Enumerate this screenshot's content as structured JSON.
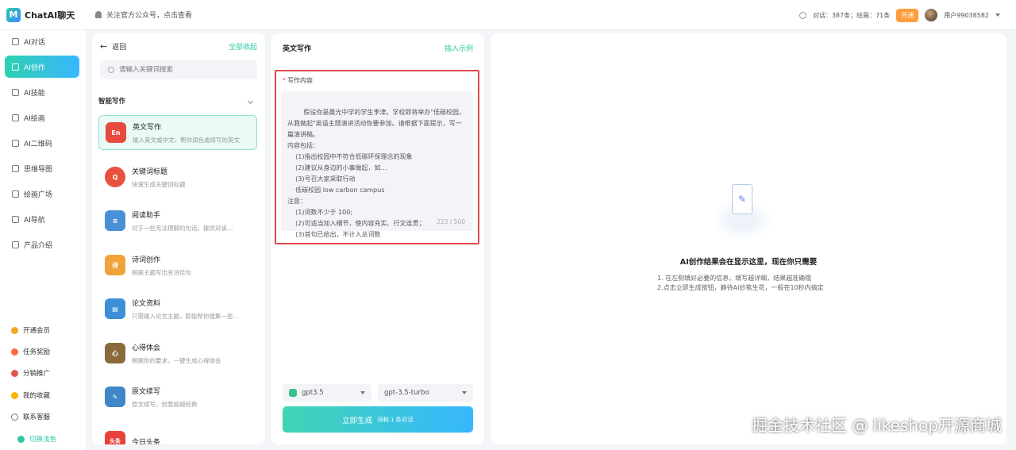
{
  "app": {
    "name": "ChatAI聊天",
    "logo_letter": "M",
    "notice": "关注官方公众号，点击查看"
  },
  "top_right": {
    "stats": "对话：387条；绘画：71条",
    "vip_label": "开通",
    "username": "用户99038582"
  },
  "nav": {
    "items": [
      {
        "label": "AI对话",
        "icon": "chat-icon"
      },
      {
        "label": "AI创作",
        "icon": "pen-icon",
        "active": true
      },
      {
        "label": "AI技能",
        "icon": "grid-icon"
      },
      {
        "label": "AI绘画",
        "icon": "palette-icon"
      },
      {
        "label": "AI二维码",
        "icon": "qrcode-icon"
      },
      {
        "label": "思维导图",
        "icon": "mindmap-icon"
      },
      {
        "label": "绘画广场",
        "icon": "gallery-icon"
      },
      {
        "label": "AI导航",
        "icon": "nav-icon"
      },
      {
        "label": "产品介绍",
        "icon": "doc-icon"
      }
    ],
    "bottom": [
      {
        "label": "开通会员",
        "color": "#f5a623"
      },
      {
        "label": "任务奖励",
        "color": "#ff6a3d"
      },
      {
        "label": "分销推广",
        "color": "#e2574c"
      },
      {
        "label": "我的收藏",
        "color": "#f7b500"
      },
      {
        "label": "联系客服",
        "color": "#777777"
      },
      {
        "label": "切换浅色",
        "color": "#2ec8a6"
      }
    ]
  },
  "panel1": {
    "back_label": "返回",
    "collapse_label": "全部收起",
    "search_placeholder": "请输入关键词搜索",
    "section_title": "智能写作",
    "cards": [
      {
        "title": "英文写作",
        "desc": "输入英文或中文，帮你润色或续写的英文",
        "color": "#e84a3d",
        "badge": "En"
      },
      {
        "title": "关键词标题",
        "desc": "快速生成关键词标题",
        "color": "#e8513d",
        "badge": "Q"
      },
      {
        "title": "阅读助手",
        "desc": "对于一些无法理解的句话，提供对该…",
        "color": "#4b8fd8",
        "badge": "≡"
      },
      {
        "title": "诗词创作",
        "desc": "根据主题写出名诗佳句",
        "color": "#f0a33a",
        "badge": "诗"
      },
      {
        "title": "论文资料",
        "desc": "只需输入论文主题，即能帮你搜集一些…",
        "color": "#3c8fd6",
        "badge": "▤"
      },
      {
        "title": "心得体会",
        "desc": "根据你的要求，一键生成心得体会",
        "color": "#8a6a3a",
        "badge": "心"
      },
      {
        "title": "原文续写",
        "desc": "原文续写，创意超越经典",
        "color": "#3f87c8",
        "badge": "✎"
      },
      {
        "title": "今日头条",
        "desc": "",
        "color": "#e8423a",
        "badge": "头条"
      }
    ]
  },
  "panel2": {
    "title": "英文写作",
    "insert_example": "插入示例",
    "field_label": "写作内容",
    "content": "  假设你是晨光中学的学生李津。学校即将举办\"低碳校园，从我做起\"英语主题演讲活动你要参加。请根据下面提示，写一篇演讲稿。\n内容包括：\n    (1)指出校园中不符合低碳环保理念的现象\n    (2)建议从身边的小事做起，如…\n    (3)号召大家采取行动\n    低碳校园 low carbon campus\n注意：\n    (1)词数不少于 100;\n    (2)可适当加入细节，使内容充实、行文连贯；\n    (3)首句已给出，不计入总词数",
    "counter": "223 / 500",
    "model_a": "gpt3.5",
    "model_b": "gpt-3.5-turbo",
    "generate_label": "立即生成",
    "generate_hint": "消耗 1 条对话"
  },
  "panel3": {
    "empty_title": "AI创作结果会在显示这里，现在你只需要",
    "tips": [
      "1. 在左侧填好必要的信息，填写越详细，结果越准确哦",
      "2.点击立即生成按钮，静待AI妙笔生花，一般在10秒内搞定"
    ]
  },
  "watermark": "掘金技术社区 @ likeshop开源商城"
}
